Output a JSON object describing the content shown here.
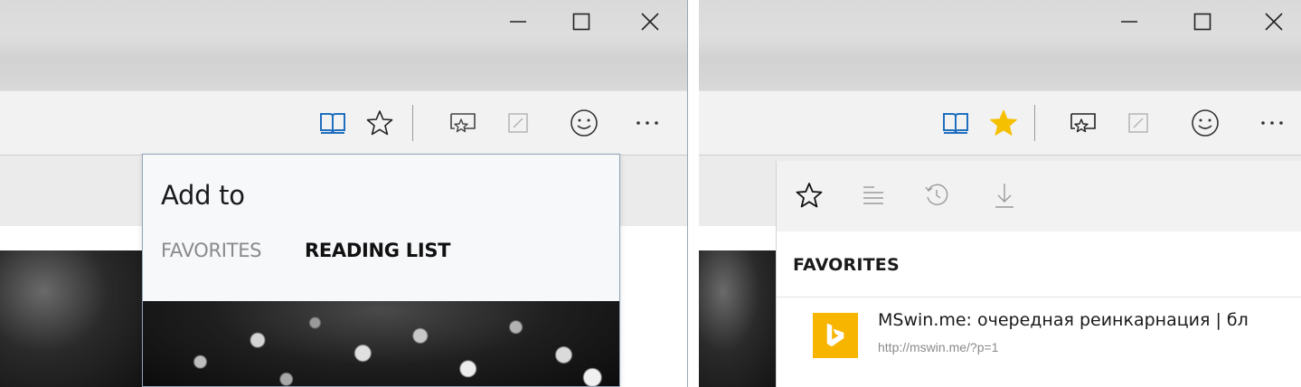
{
  "left_window": {
    "title_bar": {
      "minimize_icon": "minimize-icon",
      "maximize_icon": "maximize-icon",
      "close_icon": "close-icon"
    },
    "toolbar": {
      "icons": [
        "reading-view-icon",
        "add-favorites-star-icon",
        "hub-icon",
        "web-note-icon",
        "feedback-smiley-icon",
        "more-icon"
      ],
      "reading_view_color": "#1f6fbf"
    },
    "add_to_popup": {
      "title": "Add to",
      "tabs": [
        {
          "label": "FAVORITES",
          "active": false
        },
        {
          "label": "READING LIST",
          "active": true
        }
      ]
    }
  },
  "right_window": {
    "title_bar": {
      "minimize_icon": "minimize-icon",
      "maximize_icon": "maximize-icon",
      "close_icon": "close-icon"
    },
    "toolbar": {
      "icons": [
        "reading-view-icon",
        "favorite-star-filled-icon",
        "hub-icon",
        "web-note-icon",
        "feedback-smiley-icon",
        "more-icon"
      ],
      "star_color": "#f5c000"
    },
    "hub": {
      "tabs": [
        "favorites-tab-icon",
        "reading-list-tab-icon",
        "history-tab-icon",
        "downloads-tab-icon"
      ],
      "heading": "FAVORITES",
      "items": [
        {
          "title": "MSwin.me: очередная реинкарнация | бл",
          "url": "http://mswin.me/?p=1",
          "icon": "bing-icon",
          "icon_color": "#f7b500"
        }
      ]
    }
  }
}
